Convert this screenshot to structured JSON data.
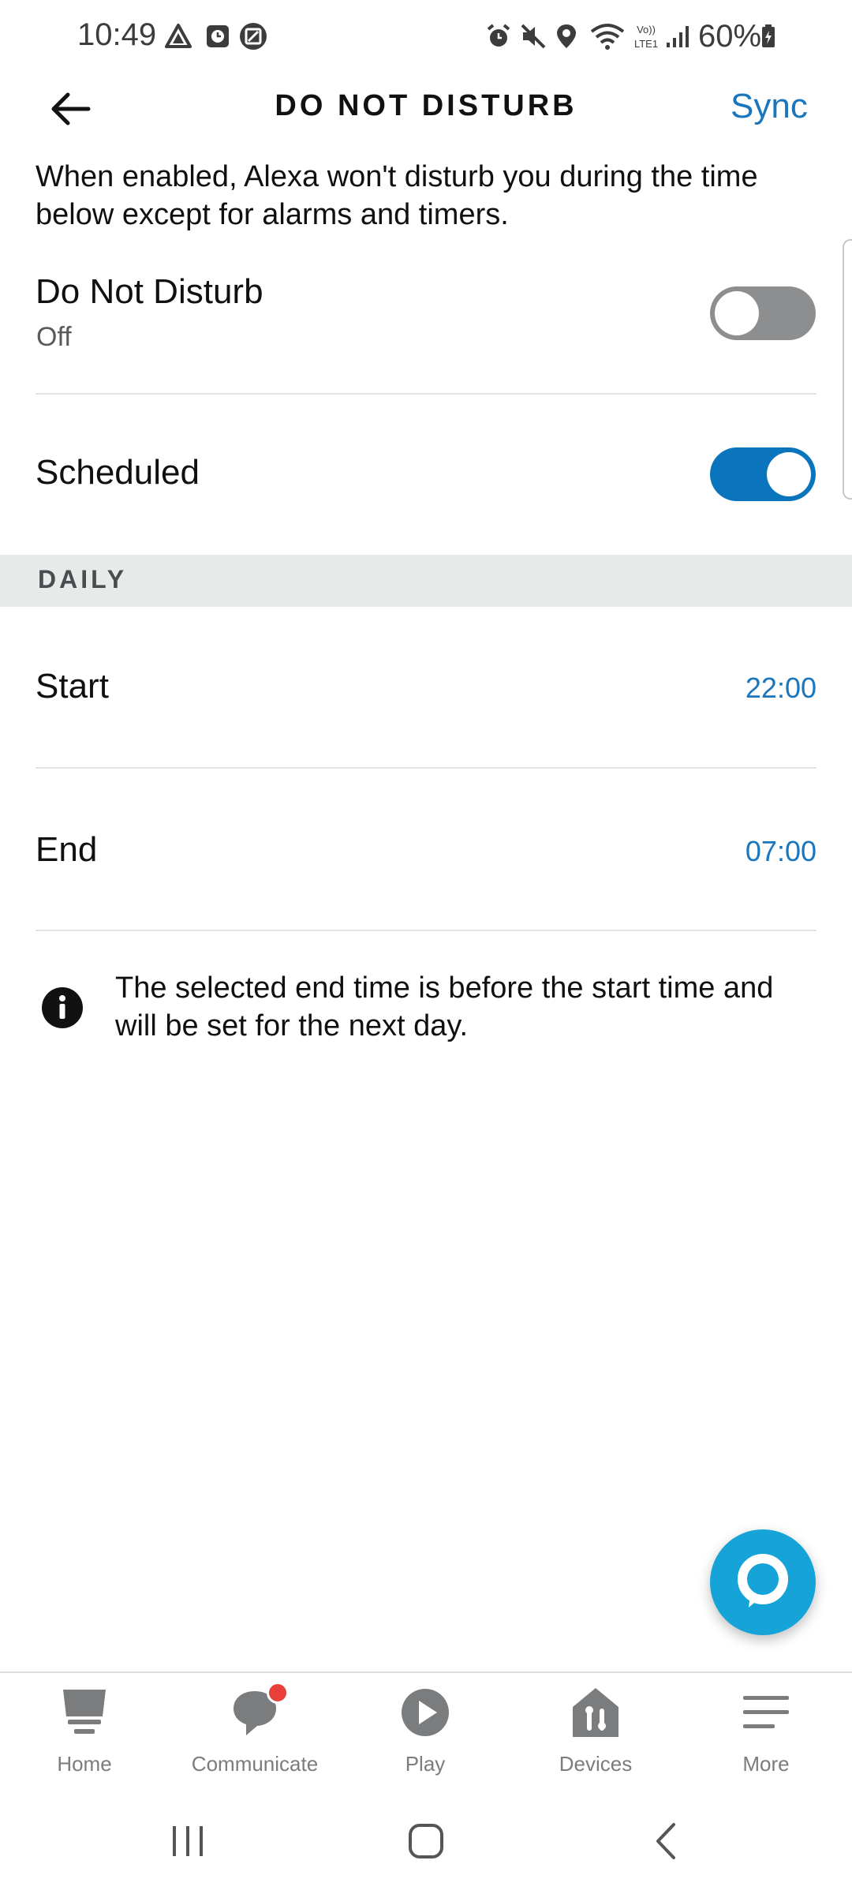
{
  "status_bar": {
    "time": "10:49",
    "battery": "60%",
    "left_icons": [
      "drive-icon",
      "clock-app-icon",
      "gallery-icon"
    ],
    "right_icons": [
      "alarm-icon",
      "mute-icon",
      "location-icon",
      "wifi-icon",
      "volte-icon",
      "signal-icon",
      "battery-icon"
    ]
  },
  "header": {
    "title": "DO NOT DISTURB",
    "sync_label": "Sync"
  },
  "description": "When enabled, Alexa won't disturb you during the time below except for alarms and timers.",
  "dnd": {
    "label": "Do Not Disturb",
    "status": "Off",
    "enabled": false
  },
  "scheduled": {
    "label": "Scheduled",
    "enabled": true
  },
  "section_label": "DAILY",
  "start": {
    "label": "Start",
    "value": "22:00"
  },
  "end": {
    "label": "End",
    "value": "07:00"
  },
  "info_message": "The selected end time is before the start time and will be set for the next day.",
  "bottom_nav": {
    "items": [
      {
        "label": "Home",
        "icon": "home-icon"
      },
      {
        "label": "Communicate",
        "icon": "chat-icon",
        "badge": true
      },
      {
        "label": "Play",
        "icon": "play-icon"
      },
      {
        "label": "Devices",
        "icon": "devices-icon"
      },
      {
        "label": "More",
        "icon": "menu-icon"
      }
    ]
  },
  "colors": {
    "accent": "#1a76bd",
    "toggle_on": "#0a74bd",
    "toggle_off": "#8c8e90",
    "alexa": "#16a3d8",
    "badge": "#e8413b"
  }
}
